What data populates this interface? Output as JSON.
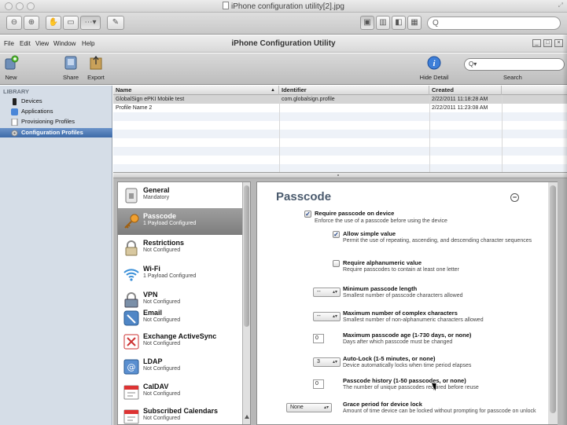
{
  "viewer": {
    "title": "iPhone configuration utility[2].jpg",
    "search_placeholder": "Q"
  },
  "app": {
    "title": "iPhone Configuration Utility",
    "menu": [
      "File",
      "Edit",
      "View",
      "Window",
      "Help"
    ],
    "toolbar": {
      "new": "New",
      "share": "Share",
      "export": "Export",
      "hide_detail": "Hide Detail",
      "search_label": "Search",
      "search_placeholder": "Q▾"
    }
  },
  "sidebar": {
    "header": "LIBRARY",
    "items": [
      {
        "label": "Devices"
      },
      {
        "label": "Applications"
      },
      {
        "label": "Provisioning Profiles"
      },
      {
        "label": "Configuration Profiles",
        "selected": true
      }
    ]
  },
  "table": {
    "columns": [
      "Name",
      "Identifier",
      "Created"
    ],
    "rows": [
      {
        "name": "GlobalSign ePKI Mobile test",
        "identifier": "com.globalsign.profile",
        "created": "2/22/2011 11:18:28 AM"
      },
      {
        "name": "Profile Name 2",
        "identifier": "",
        "created": "2/22/2011 11:23:08 AM"
      }
    ]
  },
  "payloads": [
    {
      "title": "General",
      "subtitle": "Mandatory",
      "icon": "general-icon"
    },
    {
      "title": "Passcode",
      "subtitle": "1 Payload Configured",
      "icon": "key-icon",
      "selected": true
    },
    {
      "title": "Restrictions",
      "subtitle": "Not Configured",
      "icon": "lock-icon"
    },
    {
      "title": "Wi-Fi",
      "subtitle": "1 Payload Configured",
      "icon": "wifi-icon"
    },
    {
      "title": "VPN",
      "subtitle": "Not Configured",
      "icon": "vpn-icon"
    },
    {
      "title": "Email",
      "subtitle": "Not Configured",
      "icon": "email-icon"
    },
    {
      "title": "Exchange ActiveSync",
      "subtitle": "Not Configured",
      "icon": "exchange-icon"
    },
    {
      "title": "LDAP",
      "subtitle": "Not Configured",
      "icon": "ldap-icon"
    },
    {
      "title": "CalDAV",
      "subtitle": "Not Configured",
      "icon": "calendar-icon"
    },
    {
      "title": "Subscribed Calendars",
      "subtitle": "Not Configured",
      "icon": "calendar-icon"
    }
  ],
  "passcode": {
    "title": "Passcode",
    "require": {
      "title": "Require passcode on device",
      "desc": "Enforce the use of a passcode before using the device",
      "checked": true
    },
    "simple": {
      "title": "Allow simple value",
      "desc": "Permit the use of repeating, ascending, and descending character sequences",
      "checked": true
    },
    "alnum": {
      "title": "Require alphanumeric value",
      "desc": "Require passcodes to contain at least one letter",
      "checked": false
    },
    "min_length": {
      "title": "Minimum passcode length",
      "desc": "Smallest number of passcode characters allowed",
      "value": "--"
    },
    "min_complex": {
      "title": "Maximum number of complex characters",
      "desc": "Smallest number of non-alphanumeric characters allowed",
      "value": "--"
    },
    "max_age": {
      "title": "Maximum passcode age (1-730 days, or none)",
      "desc": "Days after which passcode must be changed",
      "value": "0"
    },
    "autolock": {
      "title": "Auto-Lock (1-5 minutes, or none)",
      "desc": "Device automatically locks when time period elapses",
      "value": "3"
    },
    "history": {
      "title": "Passcode history (1-50 passcodes, or none)",
      "desc": "The number of unique passcodes required before reuse",
      "value": "0"
    },
    "grace": {
      "title": "Grace period for device lock",
      "desc": "Amount of time device can be locked without prompting for passcode on unlock",
      "value": "None"
    }
  }
}
